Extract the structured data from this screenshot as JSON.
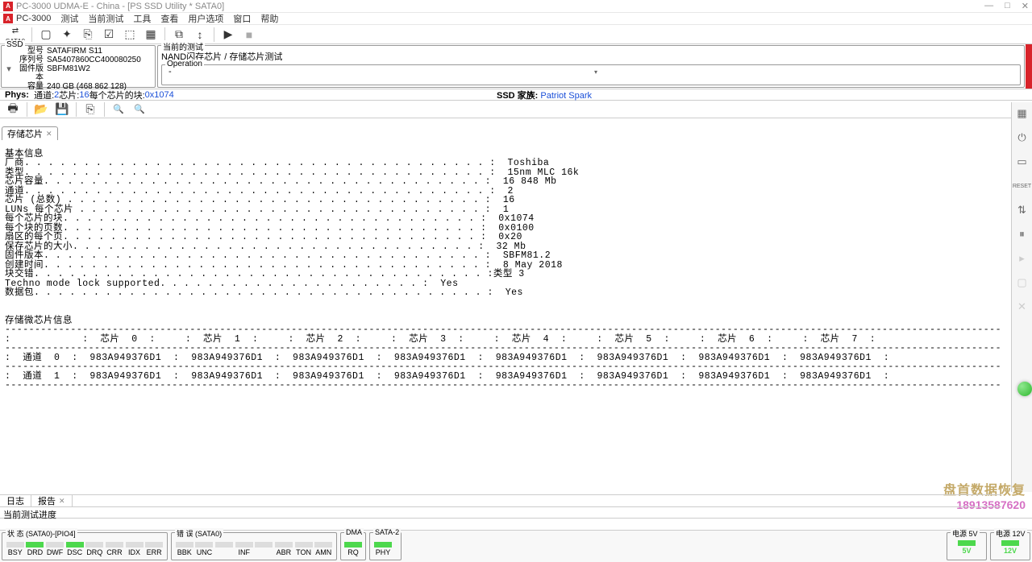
{
  "titlebar": {
    "title": "PC-3000 UDMA-E - China - [PS SSD Utility * SATA0]"
  },
  "menubar": {
    "app": "PC-3000",
    "items": [
      "测试",
      "当前测试",
      "工具",
      "查看",
      "用户选项",
      "窗口",
      "帮助"
    ]
  },
  "sata_label": "SATA0",
  "ssd_panel": {
    "legend": "SSD",
    "rows": [
      {
        "lbl": "型号",
        "val": "SATAFIRM   S11"
      },
      {
        "lbl": "序列号",
        "val": "SA5407860CC400080250"
      },
      {
        "lbl": "固件版本",
        "val": "SBFM81W2"
      },
      {
        "lbl": "容量",
        "val": "240 GB (468 862 128)"
      }
    ]
  },
  "test_panel": {
    "legend": "当前的测试",
    "path": "NAND闪存芯片 / 存储芯片测试",
    "op_legend": "Operation",
    "op_value": "-"
  },
  "status_line": {
    "phys": "Phys:",
    "ch_lbl": "通道: ",
    "ch_val": "2",
    "chip_lbl": " 芯片: ",
    "chip_val": "16",
    "blk_lbl": " 每个芯片的块: ",
    "blk_val": "0x1074",
    "ssd_family_lbl": "SSD 家族: ",
    "ssd_family_val": "Patriot Spark"
  },
  "tabs": {
    "chip_tab": "存储芯片"
  },
  "log": {
    "header1": "基本信息",
    "lines": [
      "厂商. . . . . . . . . . . . . . . . . . . . . . . . . . . . . . . . . . . . . . . :  Toshiba",
      "类型. . . . . . . . . . . . . . . . . . . . . . . . . . . . . . . . . . . . . . . :  15nm MLC 16k",
      "芯片容量. . . . . . . . . . . . . . . . . . . . . . . . . . . . . . . . . . . . . :  16 848 Mb",
      "通道. . . . . . . . . . . . . . . . . . . . . . . . . . . . . . . . . . . . . . . :  2",
      "芯片 (总数) . . . . . . . . . . . . . . . . . . . . . . . . . . . . . . . . . . . :  16",
      "LUNs 每个芯片 . . . . . . . . . . . . . . . . . . . . . . . . . . . . . . . . . . :  1",
      "每个芯片的块. . . . . . . . . . . . . . . . . . . . . . . . . . . . . . . . . . . :  0x1074",
      "每个块的页数. . . . . . . . . . . . . . . . . . . . . . . . . . . . . . . . . . . :  0x0100",
      "扇区的每个页. . . . . . . . . . . . . . . . . . . . . . . . . . . . . . . . . . . :  0x20",
      "保存芯片的大小. . . . . . . . . . . . . . . . . . . . . . . . . . . . . . . . . . :  32 Mb",
      "固件版本. . . . . . . . . . . . . . . . . . . . . . . . . . . . . . . . . . . . . :  SBFM81.2",
      "创建时间. . . . . . . . . . . . . . . . . . . . . . . . . . . . . . . . . . . . . :  8 May 2018",
      "块交错. . . . . . . . . . . . . . . . . . . . . . . . . . . . . . . . . . . . . . :类型 3",
      "Techno mode lock supported. . . . . . . . . . . . . . . . . . . . . . :  Yes",
      "数据包. . . . . . . . . . . . . . . . . . . . . . . . . . . . . . . . . . . . . . :  Yes"
    ],
    "header2": "存储微芯片信息",
    "dash": "-------------------------------------------------------------------------------------------------------------------------------------------------------------------------",
    "chip_header": ":            :  芯片  0  :     :  芯片  1  :     :  芯片  2  :     :  芯片  3  :     :  芯片  4  :     :  芯片  5  :     :  芯片  6  :     :  芯片  7  :",
    "channel0": ":  通道  0  :  983A949376D1  :  983A949376D1  :  983A949376D1  :  983A949376D1  :  983A949376D1  :  983A949376D1  :  983A949376D1  :  983A949376D1  :",
    "channel1": ":  通道  1  :  983A949376D1  :  983A949376D1  :  983A949376D1  :  983A949376D1  :  983A949376D1  :  983A949376D1  :  983A949376D1  :  983A949376D1  :"
  },
  "bottom_tabs": {
    "log": "日志",
    "report": "报告"
  },
  "progress_label": "当前测试进度",
  "watermark": {
    "line1": "盘首数据恢复",
    "line2": "18913587620"
  },
  "statusbar": {
    "state_label": "状 态 (SATA0)-[PIO4]",
    "state_leds": [
      {
        "t": "BSY",
        "g": false
      },
      {
        "t": "DRD",
        "g": true
      },
      {
        "t": "DWF",
        "g": false
      },
      {
        "t": "DSC",
        "g": true
      },
      {
        "t": "DRQ",
        "g": false
      },
      {
        "t": "CRR",
        "g": false
      },
      {
        "t": "IDX",
        "g": false
      },
      {
        "t": "ERR",
        "g": false
      }
    ],
    "err_label": "错 误 (SATA0)",
    "err_leds": [
      {
        "t": "BBK",
        "g": false
      },
      {
        "t": "UNC",
        "g": false
      },
      {
        "t": "",
        "g": false
      },
      {
        "t": "INF",
        "g": false
      },
      {
        "t": "",
        "g": false
      },
      {
        "t": "ABR",
        "g": false
      },
      {
        "t": "TON",
        "g": false
      },
      {
        "t": "AMN",
        "g": false
      }
    ],
    "dma_label": "DMA",
    "dma_leds": [
      {
        "t": "RQ",
        "g": true
      }
    ],
    "sata2_label": "SATA-2",
    "sata2_leds": [
      {
        "t": "PHY",
        "g": true
      }
    ],
    "pow5_label": "电源 5V",
    "pow5_val": "5V",
    "pow12_label": "电源 12V",
    "pow12_val": "12V"
  }
}
